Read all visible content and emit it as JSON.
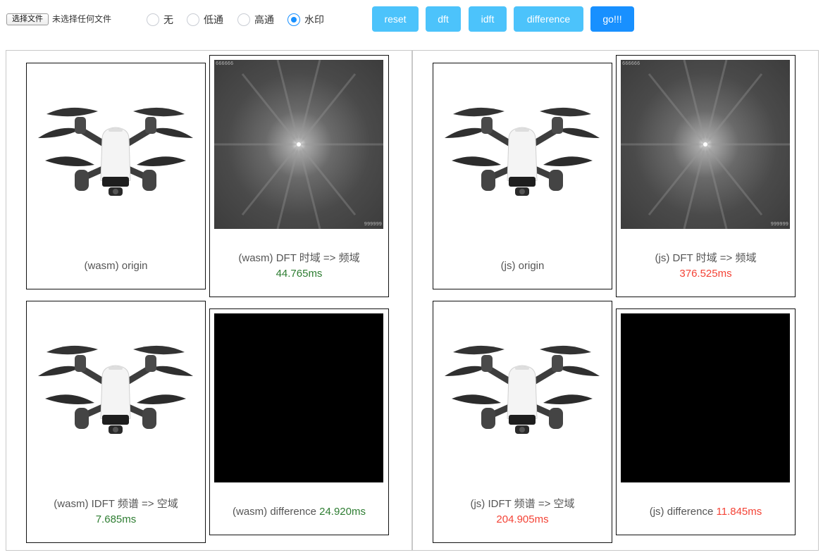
{
  "toolbar": {
    "file_button": "选择文件",
    "file_status": "未选择任何文件",
    "radios": [
      {
        "label": "无",
        "checked": false
      },
      {
        "label": "低通",
        "checked": false
      },
      {
        "label": "高通",
        "checked": false
      },
      {
        "label": "水印",
        "checked": true
      }
    ],
    "buttons": {
      "reset": "reset",
      "dft": "dft",
      "idft": "idft",
      "difference": "difference",
      "go": "go!!!"
    }
  },
  "colors": {
    "accent": "#1890ff",
    "button": "#4cc3fb",
    "fast": "#2e7d32",
    "slow": "#f44336"
  },
  "panels": {
    "wasm": {
      "origin": {
        "caption": "(wasm) origin"
      },
      "dft": {
        "caption": "(wasm) DFT 时域 => 频域",
        "time": "44.765ms",
        "watermark_top": "666666",
        "watermark_bottom": "999999"
      },
      "idft": {
        "caption": "(wasm) IDFT 频谱 => 空域",
        "time": "7.685ms"
      },
      "difference": {
        "caption": "(wasm) difference",
        "time": "24.920ms"
      }
    },
    "js": {
      "origin": {
        "caption": "(js) origin"
      },
      "dft": {
        "caption": "(js) DFT 时域 => 频域",
        "time": "376.525ms",
        "watermark_top": "666666",
        "watermark_bottom": "999999"
      },
      "idft": {
        "caption": "(js) IDFT 频谱 => 空域",
        "time": "204.905ms"
      },
      "difference": {
        "caption": "(js) difference",
        "time": "11.845ms"
      }
    }
  }
}
